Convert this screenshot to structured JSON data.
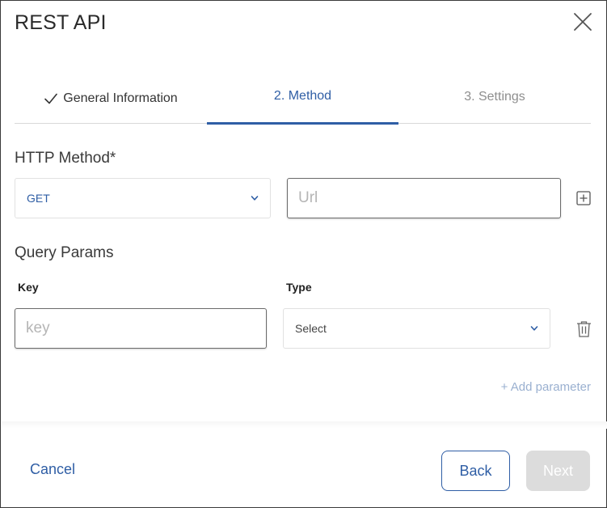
{
  "dialog": {
    "title": "REST API"
  },
  "tabs": [
    {
      "label": "General Information",
      "state": "completed",
      "icon": "check-icon"
    },
    {
      "label": "2. Method",
      "state": "active"
    },
    {
      "label": "3. Settings",
      "state": "inactive"
    }
  ],
  "http_method": {
    "label": "HTTP Method*",
    "selected": "GET",
    "url_placeholder": "Url"
  },
  "query_params": {
    "label": "Query Params",
    "key_header": "Key",
    "type_header": "Type",
    "key_placeholder": "key",
    "type_selected": "Select",
    "add_parameter": "+ Add parameter"
  },
  "footer": {
    "cancel": "Cancel",
    "back": "Back",
    "next": "Next"
  },
  "colors": {
    "accent": "#2f5ea5",
    "link_muted": "#9ab0d0",
    "disabled_button": "#dcdcdc"
  }
}
